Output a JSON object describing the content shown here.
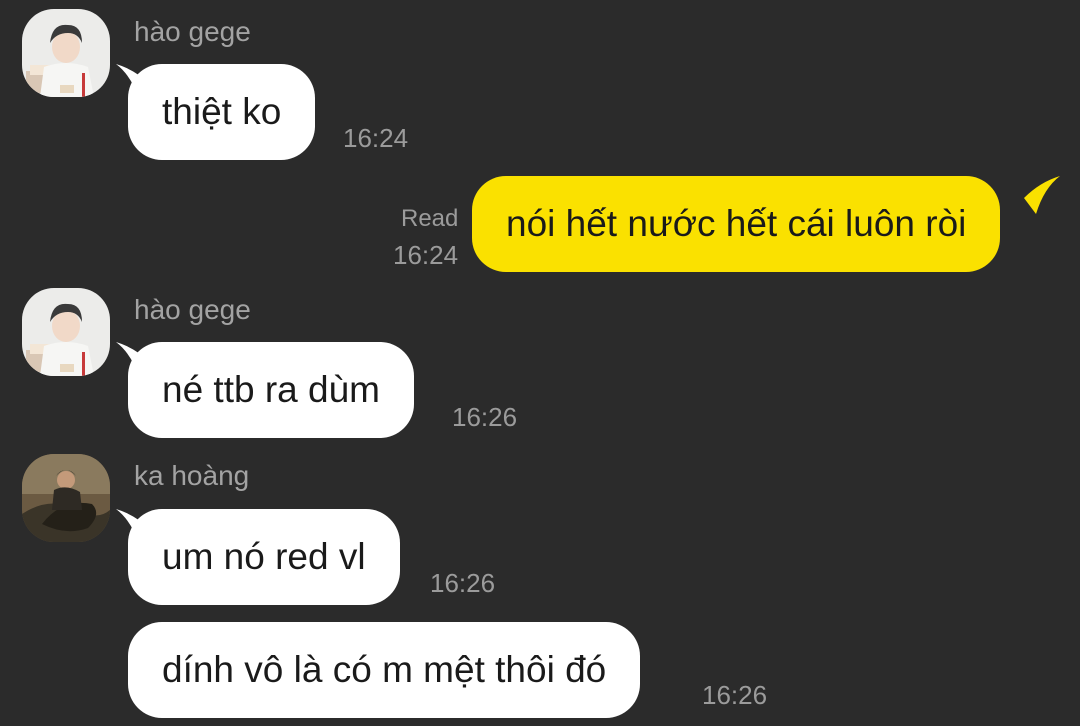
{
  "colors": {
    "background": "#2b2b2b",
    "incoming_bubble": "#ffffff",
    "outgoing_bubble": "#fae100",
    "meta_text": "#9b9b9b"
  },
  "messages": [
    {
      "direction": "incoming",
      "sender": "hào gege",
      "avatar": "avatar-hao-gege",
      "text": "thiệt ko",
      "time": "16:24"
    },
    {
      "direction": "outgoing",
      "status": "Read",
      "text": "nói hết nước hết cái luôn ròi",
      "time": "16:24"
    },
    {
      "direction": "incoming",
      "sender": "hào gege",
      "avatar": "avatar-hao-gege",
      "text": "né ttb ra dùm",
      "time": "16:26"
    },
    {
      "direction": "incoming",
      "sender": "ka hoàng",
      "avatar": "avatar-ka-hoang",
      "text": "um nó red vl",
      "time": "16:26"
    },
    {
      "direction": "incoming",
      "text": "dính vô là có m mệt thôi đó",
      "time": "16:26"
    }
  ]
}
